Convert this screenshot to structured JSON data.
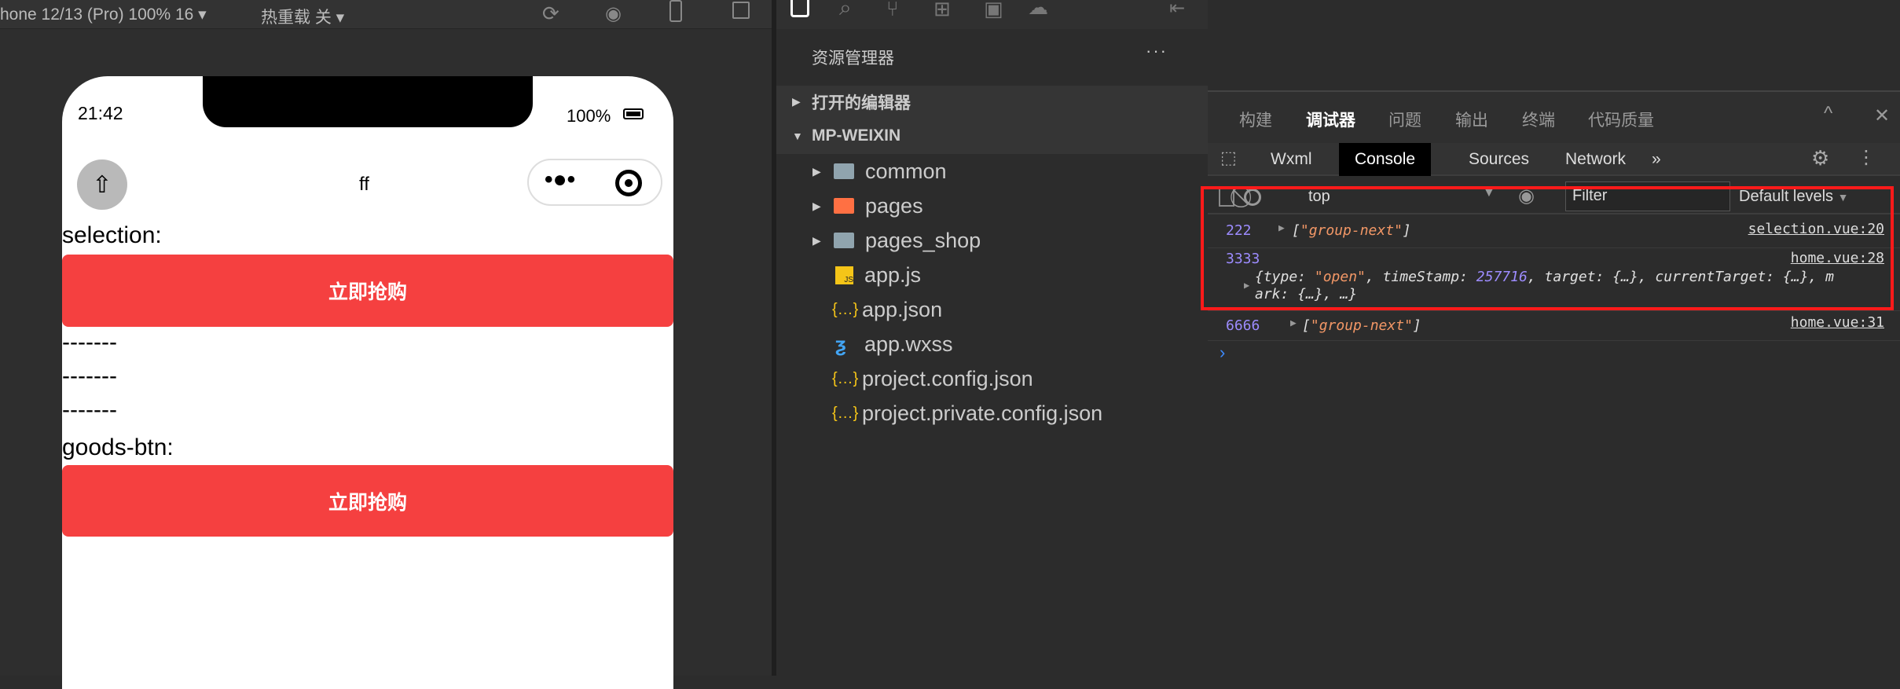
{
  "toolbar": {
    "device": "hone 12/13 (Pro) 100% 16",
    "hot_reload": "热重载 关"
  },
  "phone": {
    "time": "21:42",
    "battery": "100%",
    "nav_title": "ff",
    "selection_label": "selection:",
    "buy_label": "立即抢购",
    "dashes": [
      "-------",
      "-------",
      "-------"
    ],
    "goods_label": "goods-btn:",
    "buy_label2": "立即抢购"
  },
  "explorer": {
    "title": "资源管理器",
    "more": "···",
    "open_editors": "打开的编辑器",
    "project": "MP-WEIXIN",
    "items": [
      {
        "name": "common",
        "type": "folder"
      },
      {
        "name": "pages",
        "type": "folder-pages"
      },
      {
        "name": "pages_shop",
        "type": "folder"
      },
      {
        "name": "app.js",
        "type": "js"
      },
      {
        "name": "app.json",
        "type": "json"
      },
      {
        "name": "app.wxss",
        "type": "css"
      },
      {
        "name": "project.config.json",
        "type": "json"
      },
      {
        "name": "project.private.config.json",
        "type": "json"
      }
    ]
  },
  "devtools": {
    "tabs": [
      "构建",
      "调试器",
      "问题",
      "输出",
      "终端",
      "代码质量"
    ],
    "active_tab": "调试器",
    "panels": [
      "Wxml",
      "Console",
      "Sources",
      "Network"
    ],
    "more": "»",
    "active_panel": "Console",
    "context": "top",
    "filter_placeholder": "Filter",
    "levels": "Default levels",
    "logs": [
      {
        "num": "222",
        "text": "group-next",
        "source": "selection.vue:20"
      },
      {
        "num": "3333",
        "source": "home.vue:28",
        "obj_pre": "{type: ",
        "obj_type": "\"open\"",
        "obj_mid": ", timeStamp: ",
        "obj_ts": "257716",
        "obj_rest": ", target: {…}, currentTarget: {…}, m",
        "obj_line2": "ark: {…}, …}"
      },
      {
        "num": "6666",
        "text": "group-next",
        "source": "home.vue:31"
      }
    ],
    "highlight_color": "#ff1a1a"
  }
}
